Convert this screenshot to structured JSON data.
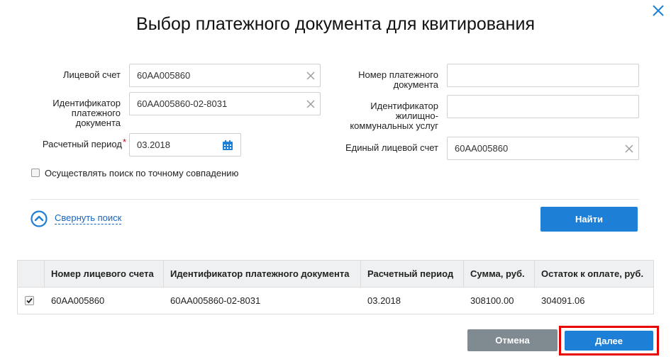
{
  "dialog": {
    "title": "Выбор платежного документа для квитирования"
  },
  "form": {
    "account_label": "Лицевой счет",
    "account_value": "60АА005860",
    "doc_id_label_1": "Идентификатор",
    "doc_id_label_2": "платежного",
    "doc_id_label_3": "документа",
    "doc_id_value": "60АА005860-02-8031",
    "period_label": "Расчетный период",
    "period_required_mark": "*",
    "period_value": "03.2018",
    "doc_number_label_1": "Номер платежного",
    "doc_number_label_2": "документа",
    "doc_number_value": "",
    "hcs_id_label_1": "Идентификатор",
    "hcs_id_label_2": "жилищно-",
    "hcs_id_label_3": "коммунальных услуг",
    "hcs_id_value": "",
    "unified_account_label": "Единый лицевой счет",
    "unified_account_value": "60АА005860",
    "exact_match_label": "Осуществлять поиск по точному совпадению",
    "exact_match_checked": false
  },
  "search": {
    "collapse_label": "Свернуть поиск",
    "find_label": "Найти"
  },
  "table": {
    "columns": [
      "Номер лицевого счета",
      "Идентификатор платежного документа",
      "Расчетный период",
      "Сумма, руб.",
      "Остаток к оплате, руб."
    ],
    "rows": [
      {
        "checked": true,
        "cells": [
          "60АА005860",
          "60АА005860-02-8031",
          "03.2018",
          "308100.00",
          "304091.06"
        ]
      }
    ]
  },
  "footer": {
    "cancel_label": "Отмена",
    "next_label": "Далее"
  },
  "colors": {
    "primary": "#1e7fd6",
    "secondary": "#808b91",
    "highlight": "#e60000",
    "link": "#1565c0"
  },
  "icons": {
    "close": "close-icon",
    "clear": "clear-icon",
    "calendar": "calendar-icon",
    "collapse": "chevron-up-circle-icon",
    "check": "checkmark-icon"
  }
}
